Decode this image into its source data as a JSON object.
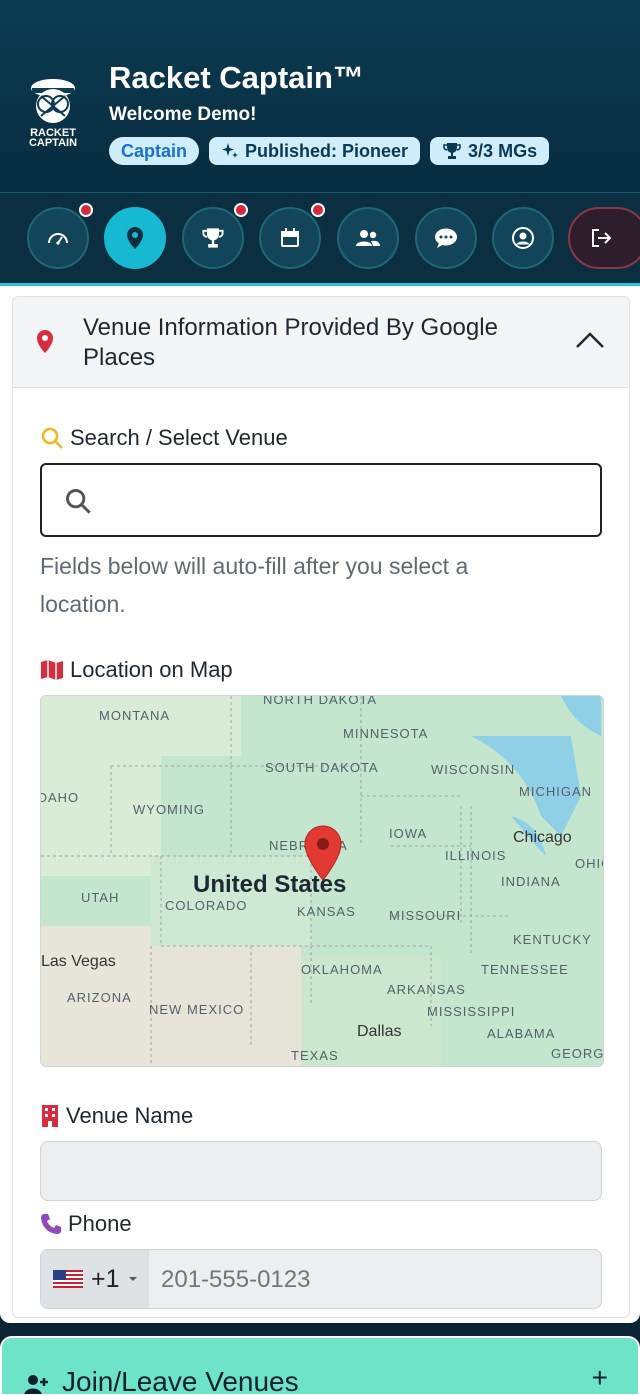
{
  "header": {
    "logo_text_line1": "RACKET",
    "logo_text_line2": "CAPTAIN",
    "title": "Racket Captain™",
    "welcome": "Welcome Demo!",
    "badges": {
      "role": "Captain",
      "published": "Published: Pioneer",
      "mgs": "3/3 MGs"
    }
  },
  "nav": {
    "items": [
      {
        "name": "dashboard",
        "icon": "gauge-icon",
        "badge": true
      },
      {
        "name": "venues",
        "icon": "map-pin-icon",
        "badge": false,
        "active": true
      },
      {
        "name": "trophies",
        "icon": "trophy-icon",
        "badge": true
      },
      {
        "name": "calendar",
        "icon": "calendar-icon",
        "badge": true
      },
      {
        "name": "people",
        "icon": "users-icon",
        "badge": false
      },
      {
        "name": "messages",
        "icon": "chat-icon",
        "badge": false
      },
      {
        "name": "profile",
        "icon": "user-circle-icon",
        "badge": false
      },
      {
        "name": "logout",
        "icon": "logout-icon",
        "badge": false
      }
    ]
  },
  "venue_card": {
    "title": "Venue Information Provided By Google Places",
    "search_label": "Search / Select Venue",
    "search_value": "",
    "help_text": "Fields below will auto-fill after you select a location.",
    "map_label": "Location on Map",
    "map": {
      "country_label": "United States",
      "labels": [
        "NORTH DAKOTA",
        "MONTANA",
        "MINNESOTA",
        "SOUTH DAKOTA",
        "WISCONSIN",
        "MICHIGAN",
        "IDAHO",
        "WYOMING",
        "IOWA",
        "Chicago",
        "NEBRASKA",
        "ILLINOIS",
        "OHIO",
        "INDIANA",
        "UTAH",
        "COLORADO",
        "KANSAS",
        "MISSOURI",
        "KENTUCKY",
        "Las Vegas",
        "OKLAHOMA",
        "TENNESSEE",
        "ARKANSAS",
        "ARIZONA",
        "NEW MEXICO",
        "MISSISSIPPI",
        "Dallas",
        "ALABAMA",
        "TEXAS",
        "GEORGIA"
      ]
    },
    "venue_name_label": "Venue Name",
    "venue_name_value": "",
    "phone_label": "Phone",
    "phone_country_code": "+1",
    "phone_placeholder": "201-555-0123"
  },
  "join_section": {
    "title": "Join/Leave Venues",
    "toggle": "+"
  },
  "colors": {
    "header_bg": "#0c3b52",
    "accent": "#17b8d2",
    "badge_bg": "#cfeefa",
    "alert_dot": "#d8283b",
    "join_bg": "#6de3c8"
  }
}
